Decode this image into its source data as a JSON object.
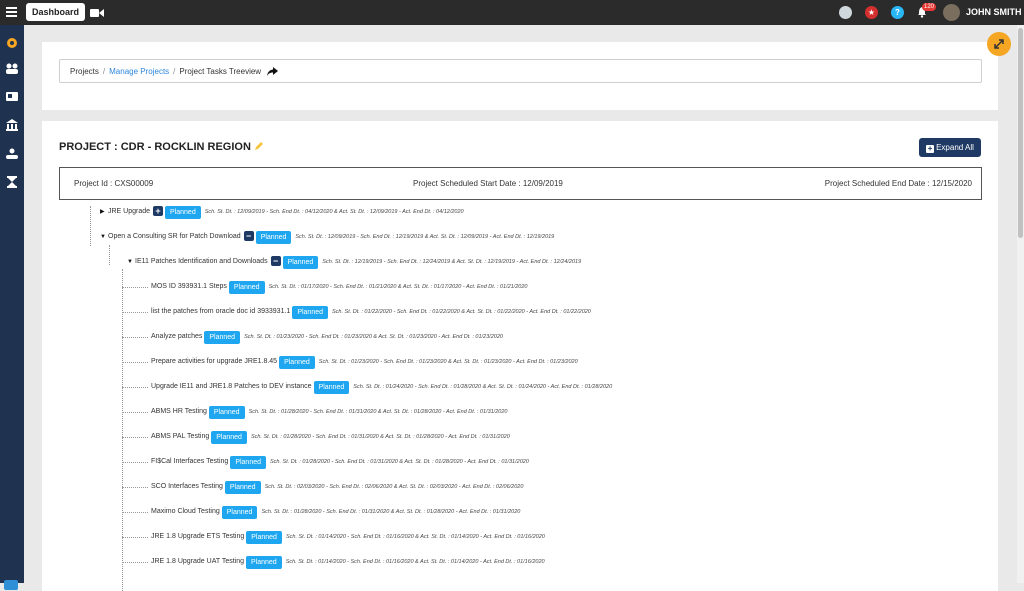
{
  "topbar": {
    "dashboard_label": "Dashboard",
    "notification_count": "120",
    "user_name": "JOHN SMITH",
    "icons": [
      "menu-icon",
      "video-icon",
      "user-icon",
      "star-icon",
      "help-icon",
      "bell-icon"
    ]
  },
  "sidebar": {
    "icons": [
      "gear-icon",
      "users-icon",
      "id-card-icon",
      "bank-icon",
      "handshake-icon",
      "hourglass-icon",
      "app-icon"
    ]
  },
  "breadcrumb": {
    "items": [
      "Projects",
      "Manage Projects",
      "Project Tasks Treeview"
    ],
    "separator": "/"
  },
  "project": {
    "title": "PROJECT : CDR - ROCKLIN REGION",
    "expand_all_label": "Expand All",
    "id_text": "Project Id : CXS00009",
    "start_text": "Project Scheduled Start Date : 12/09/2019",
    "end_text": "Project Scheduled End Date : 12/15/2020"
  },
  "tree": {
    "nodes": [
      {
        "level": 0,
        "caret": "▶",
        "toggle": "+",
        "label": "JRE Upgrade",
        "status": "Planned",
        "dates": "Sch. St. Dt. : 12/09/2019 - Sch. End Dt. : 04/12/2020 & Act. St. Dt. : 12/09/2019 - Act. End Dt. : 04/12/2020"
      },
      {
        "level": 0,
        "caret": "▼",
        "toggle": "−",
        "label": "Open a Consulting SR for Patch Download",
        "status": "Planned",
        "dates": "Sch. St. Dt. : 12/09/2019 - Sch. End Dt. : 12/19/2019 & Act. St. Dt. : 12/09/2019 - Act. End Dt. : 12/19/2019"
      },
      {
        "level": 1,
        "caret": "▼",
        "toggle": "−",
        "label": "IE11 Patches Identification and Downloads",
        "status": "Planned",
        "dates": "Sch. St. Dt. : 12/19/2019 - Sch. End Dt. : 12/24/2019 & Act. St. Dt. : 12/19/2019 - Act. End Dt. : 12/24/2019"
      },
      {
        "level": 2,
        "caret": "",
        "toggle": "",
        "label": "MOS ID 393931.1 Steps",
        "status": "Planned",
        "dates": "Sch. St. Dt. : 01/17/2020 - Sch. End Dt. : 01/21/2020 & Act. St. Dt. : 01/17/2020 - Act. End Dt. : 01/21/2020"
      },
      {
        "level": 2,
        "caret": "",
        "toggle": "",
        "label": "list the patches from oracle doc id 3933931.1",
        "status": "Planned",
        "dates": "Sch. St. Dt. : 01/22/2020 - Sch. End Dt. : 01/22/2020 & Act. St. Dt. : 01/22/2020 - Act. End Dt. : 01/22/2020"
      },
      {
        "level": 2,
        "caret": "",
        "toggle": "",
        "label": "Analyze patches",
        "status": "Planned",
        "dates": "Sch. St. Dt. : 01/23/2020 - Sch. End Dt. : 01/23/2020 & Act. St. Dt. : 01/23/2020 - Act. End Dt. : 01/23/2020"
      },
      {
        "level": 2,
        "caret": "",
        "toggle": "",
        "label": "Prepare activities for upgrade JRE1.8.45",
        "status": "Planned",
        "dates": "Sch. St. Dt. : 01/23/2020 - Sch. End Dt. : 01/23/2020 & Act. St. Dt. : 01/23/2020 - Act. End Dt. : 01/23/2020"
      },
      {
        "level": 2,
        "caret": "",
        "toggle": "",
        "label": "Upgrade IE11 and JRE1.8 Patches to DEV instance",
        "status": "Planned",
        "dates": "Sch. St. Dt. : 01/24/2020 - Sch. End Dt. : 01/28/2020 & Act. St. Dt. : 01/24/2020 - Act. End Dt. : 01/28/2020"
      },
      {
        "level": 2,
        "caret": "",
        "toggle": "",
        "label": "ABMS HR Testing",
        "status": "Planned",
        "dates": "Sch. St. Dt. : 01/28/2020 - Sch. End Dt. : 01/31/2020 & Act. St. Dt. : 01/28/2020 - Act. End Dt. : 01/31/2020"
      },
      {
        "level": 2,
        "caret": "",
        "toggle": "",
        "label": "ABMS PAL Testing",
        "status": "Planned",
        "dates": "Sch. St. Dt. : 01/28/2020 - Sch. End Dt. : 01/31/2020 & Act. St. Dt. : 01/28/2020 - Act. End Dt. : 01/31/2020"
      },
      {
        "level": 2,
        "caret": "",
        "toggle": "",
        "label": "FI$Cal Interfaces Testing",
        "status": "Planned",
        "dates": "Sch. St. Dt. : 01/28/2020 - Sch. End Dt. : 01/31/2020 & Act. St. Dt. : 01/28/2020 - Act. End Dt. : 01/31/2020"
      },
      {
        "level": 2,
        "caret": "",
        "toggle": "",
        "label": "SCO Interfaces Testing",
        "status": "Planned",
        "dates": "Sch. St. Dt. : 02/03/2020 - Sch. End Dt. : 02/06/2020 & Act. St. Dt. : 02/03/2020 - Act. End Dt. : 02/06/2020"
      },
      {
        "level": 2,
        "caret": "",
        "toggle": "",
        "label": "Maximo Cloud Testing",
        "status": "Planned",
        "dates": "Sch. St. Dt. : 01/28/2020 - Sch. End Dt. : 01/31/2020 & Act. St. Dt. : 01/28/2020 - Act. End Dt. : 01/31/2020"
      },
      {
        "level": 2,
        "caret": "",
        "toggle": "",
        "label": "JRE 1.8 Upgrade ETS Testing",
        "status": "Planned",
        "dates": "Sch. St. Dt. : 01/14/2020 - Sch. End Dt. : 01/16/2020 & Act. St. Dt. : 01/14/2020 - Act. End Dt. : 01/16/2020"
      },
      {
        "level": 2,
        "caret": "",
        "toggle": "",
        "label": "JRE 1.8 Upgrade UAT Testing",
        "status": "Planned",
        "dates": "Sch. St. Dt. : 01/14/2020 - Sch. End Dt. : 01/16/2020 & Act. St. Dt. : 01/14/2020 - Act. End Dt. : 01/16/2020"
      }
    ]
  },
  "colors": {
    "accent": "#1ea7f0",
    "navy": "#1e3a64",
    "fab": "#f5a623"
  }
}
